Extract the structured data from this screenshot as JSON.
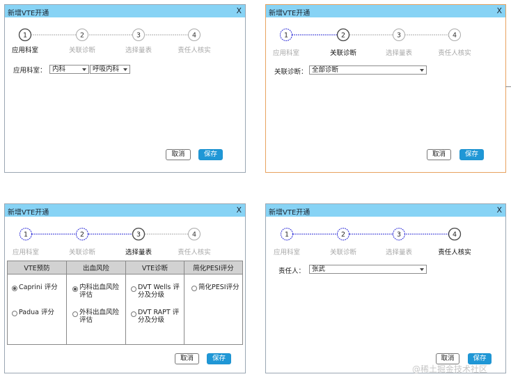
{
  "colors": {
    "titlebar": "#87d3f5",
    "save_bg": "#1f97d6",
    "circle_active": "#2b2bd6",
    "circle_inactive": "#aaaaaa",
    "orange_border": "#e8a25e"
  },
  "dialog_title": "新增VTE开通",
  "close_label": "X",
  "steps": [
    "应用科室",
    "关联诊断",
    "选择量表",
    "责任人核实"
  ],
  "step_numbers": [
    "1",
    "2",
    "3",
    "4"
  ],
  "buttons": {
    "cancel": "取消",
    "save": "保存"
  },
  "d1": {
    "label": "应用科室：",
    "select1": "内科",
    "select2": "呼吸内科"
  },
  "d2": {
    "label": "关联诊断：",
    "select": "全部诊断"
  },
  "d3": {
    "headers": [
      "VTE预防",
      "出血风险",
      "VTE诊断",
      "简化PESI评分"
    ],
    "col1": [
      "Caprini 评分",
      "Padua 评分"
    ],
    "col2": [
      "内科出血风险评估",
      "外科出血风险评估"
    ],
    "col3": [
      "DVT Wells 评分及分级",
      "DVT RAPT 评分及分级"
    ],
    "col4": [
      "简化PESI评分"
    ]
  },
  "d4": {
    "label": "责任人：",
    "select": "张武"
  },
  "watermark": "@稀土掘金技术社区"
}
